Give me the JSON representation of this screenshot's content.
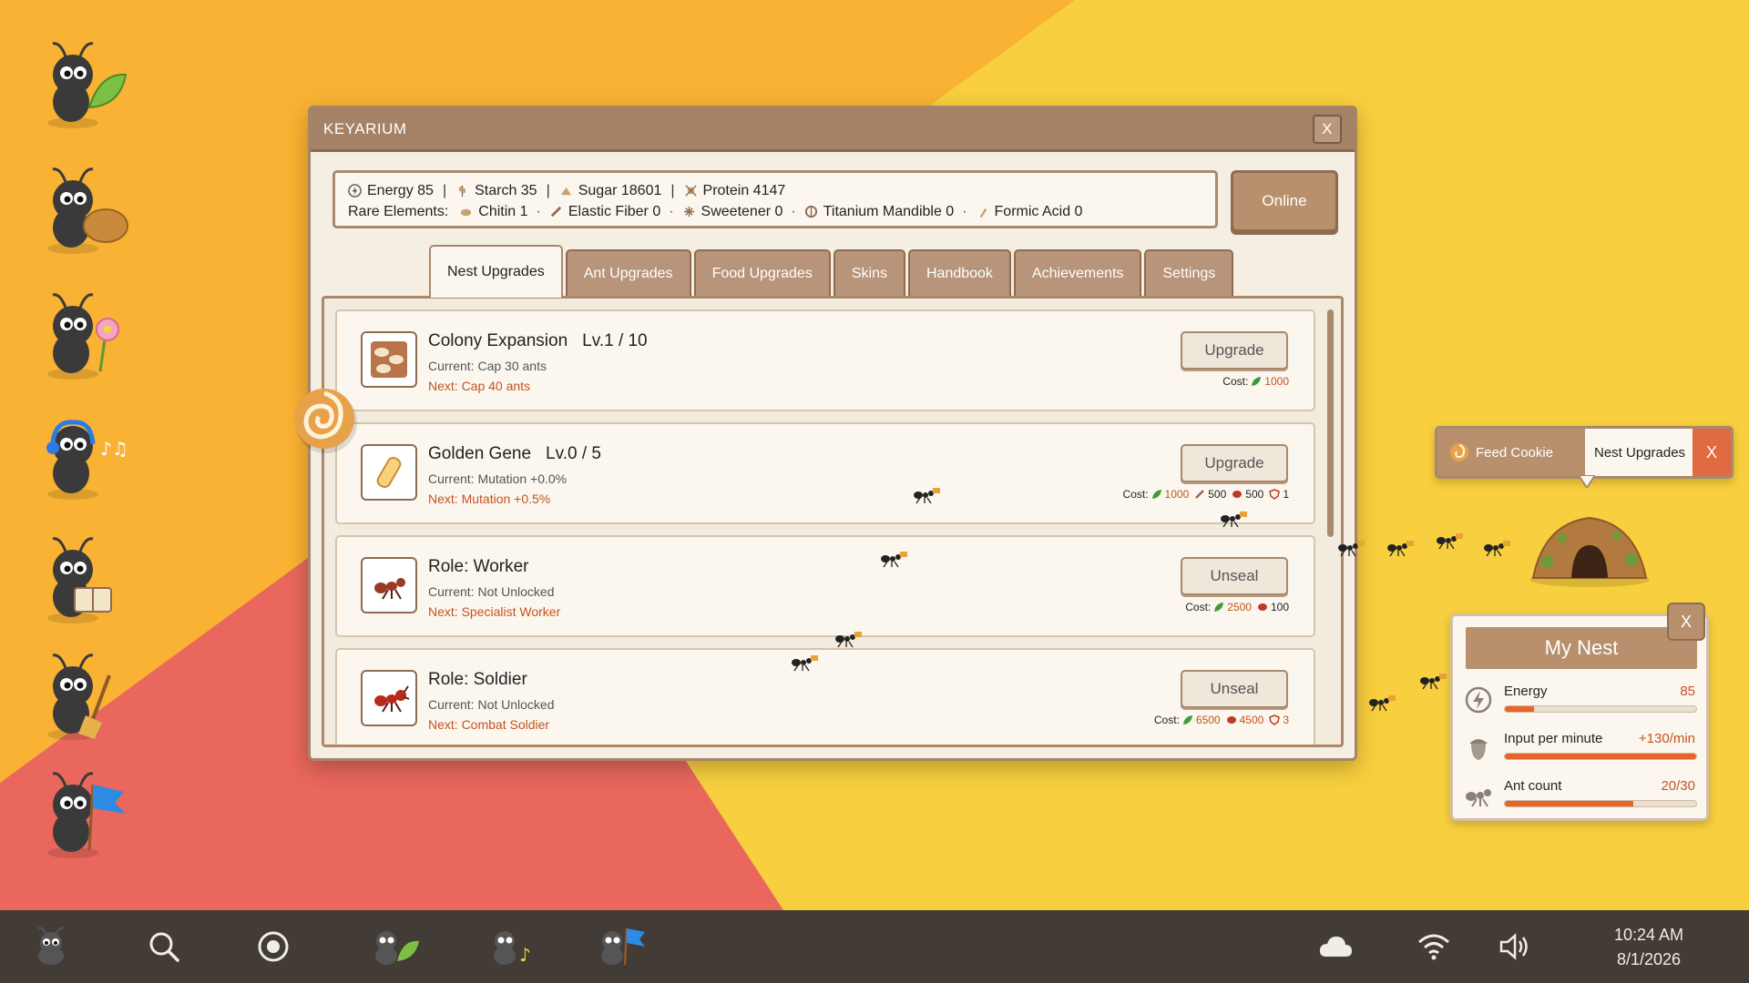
{
  "window": {
    "title": "KEYARIUM",
    "close_label": "X",
    "online_label": "Online"
  },
  "resources": {
    "energy": "Energy 85",
    "starch": "Starch 35",
    "sugar": "Sugar 18601",
    "protein": "Protein 4147",
    "rare_label": "Rare Elements:",
    "chitin": "Chitin 1",
    "elastic_fiber": "Elastic Fiber 0",
    "sweetener": "Sweetener 0",
    "titanium_mandible": "Titanium Mandible 0",
    "formic_acid": "Formic Acid 0",
    "separator": "|",
    "dot": "·"
  },
  "tabs": [
    "Nest Upgrades",
    "Ant Upgrades",
    "Food Upgrades",
    "Skins",
    "Handbook",
    "Achievements",
    "Settings"
  ],
  "cost_label": "Cost:",
  "upgrades": [
    {
      "name": "Colony Expansion",
      "level": "Lv.1 / 10",
      "current": "Current: Cap 30 ants",
      "next": "Next: Cap 40 ants",
      "button": "Upgrade",
      "costs": [
        "1000"
      ]
    },
    {
      "name": "Golden Gene",
      "level": "Lv.0 / 5",
      "current": "Current: Mutation +0.0%",
      "next": "Next: Mutation +0.5%",
      "button": "Upgrade",
      "costs": [
        "1000",
        "500",
        "500",
        "1"
      ]
    },
    {
      "name": "Role: Worker",
      "level": "",
      "current": "Current: Not Unlocked",
      "next": "Next: Specialist Worker",
      "button": "Unseal",
      "costs": [
        "2500",
        "100"
      ]
    },
    {
      "name": "Role: Soldier",
      "level": "",
      "current": "Current: Not Unlocked",
      "next": "Next: Combat Soldier",
      "button": "Unseal",
      "costs": [
        "6500",
        "4500",
        "3"
      ]
    }
  ],
  "feed_popup": {
    "feed_cookie": "Feed Cookie",
    "nest_upgrades": "Nest Upgrades",
    "close": "X"
  },
  "my_nest": {
    "title": "My Nest",
    "close": "X",
    "stats": [
      {
        "label": "Energy",
        "value": "85",
        "fill": 0.15
      },
      {
        "label": "Input per minute",
        "value": "+130/min",
        "fill": 1.0
      },
      {
        "label": "Ant count",
        "value": "20/30",
        "fill": 0.67
      }
    ]
  },
  "taskbar": {
    "time": "10:24 AM",
    "date": "8/1/2026"
  },
  "colors": {
    "window_title": "#a58266",
    "accent": "#b8906e",
    "cost_text": "#c4531f",
    "wallpaper_orange": "#f9b233",
    "wallpaper_yellow": "#f8cf3e",
    "wallpaper_red": "#e9675c",
    "taskbar": "#433b36"
  }
}
